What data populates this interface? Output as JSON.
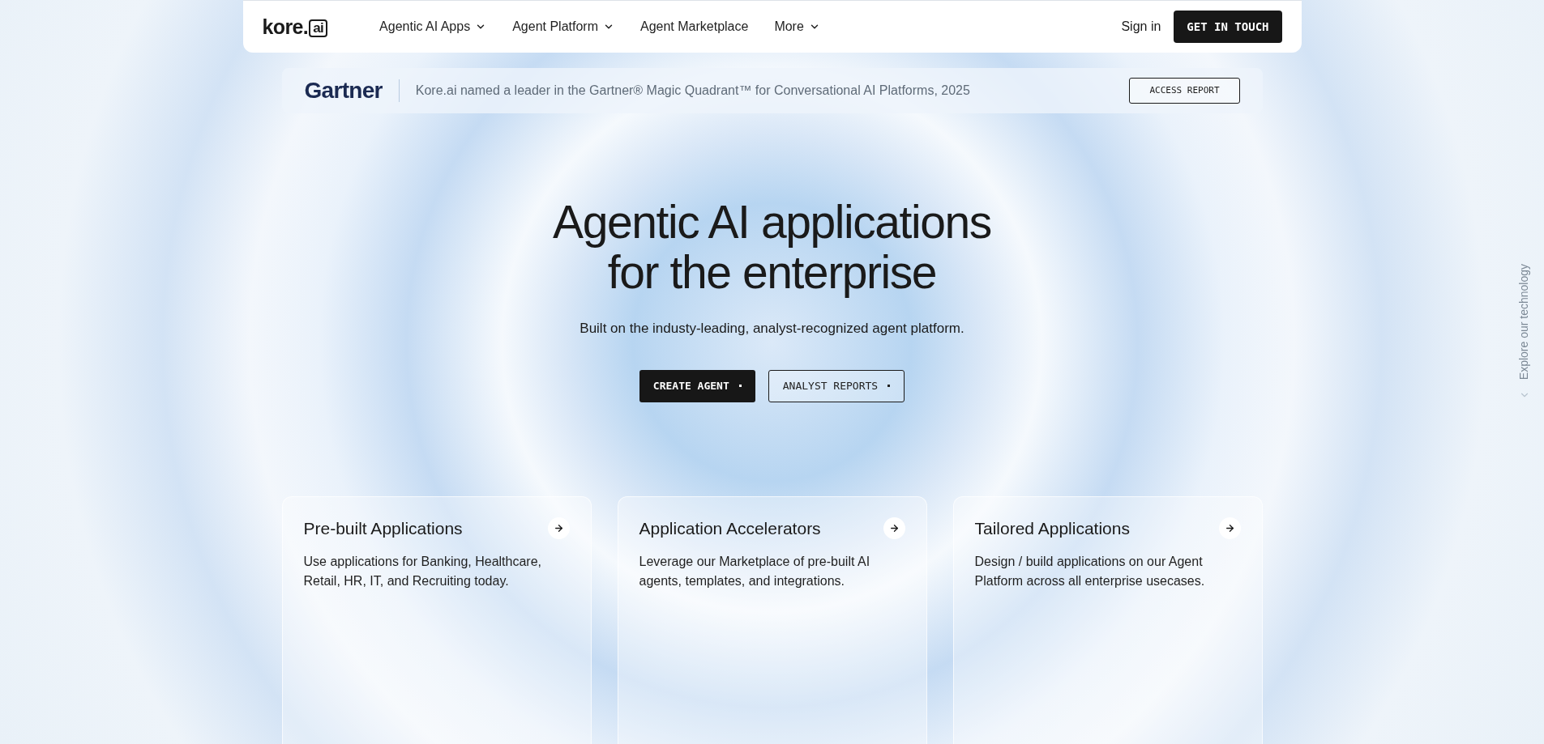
{
  "logo": {
    "name": "kore.",
    "badge": "ai"
  },
  "nav": [
    {
      "label": "Agentic AI Apps",
      "dropdown": true
    },
    {
      "label": "Agent Platform",
      "dropdown": true
    },
    {
      "label": "Agent Marketplace",
      "dropdown": false
    },
    {
      "label": "More",
      "dropdown": true
    }
  ],
  "sign_in": "Sign in",
  "cta": "GET IN TOUCH",
  "banner": {
    "brand": "Gartner",
    "text": "Kore.ai named a leader in the Gartner® Magic Quadrant™ for Conversational AI Platforms, 2025",
    "button": "ACCESS REPORT"
  },
  "hero": {
    "title_lines": [
      "Agentic AI applications",
      "for the enterprise"
    ],
    "subtitle": "Built on the industy-leading, analyst-recognized agent platform.",
    "buttons": [
      {
        "label": "CREATE AGENT",
        "kind": "primary"
      },
      {
        "label": "ANALYST REPORTS",
        "kind": "outline"
      }
    ]
  },
  "side_link": "Explore our technology",
  "cards": [
    {
      "title": "Pre-built Applications",
      "text": "Use applications for Banking, Healthcare, Retail, HR, IT, and Recruiting today."
    },
    {
      "title": "Application Accelerators",
      "text": "Leverage our Marketplace of pre-built AI agents, templates, and integrations."
    },
    {
      "title": "Tailored Applications",
      "text": "Design / build applications on our Agent Platform across all enterprise usecases."
    }
  ]
}
